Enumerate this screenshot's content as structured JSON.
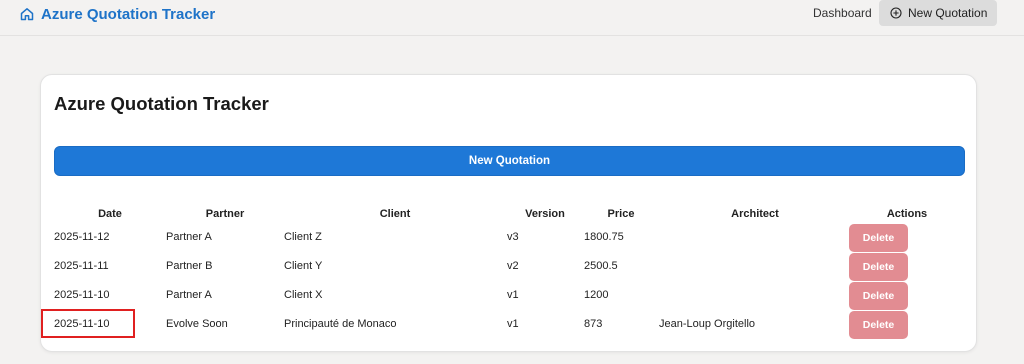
{
  "header": {
    "app_title": "Azure Quotation Tracker",
    "nav_dashboard": "Dashboard",
    "nav_new_quotation": "New Quotation"
  },
  "main": {
    "title": "Azure Quotation Tracker",
    "new_quotation_button": "New Quotation",
    "table": {
      "columns": [
        "Date",
        "Partner",
        "Client",
        "Version",
        "Price",
        "Architect",
        "Actions"
      ],
      "rows": [
        {
          "date": "2025-11-12",
          "partner": "Partner A",
          "client": "Client Z",
          "version": "v3",
          "price": "1800.75",
          "architect": "",
          "action": "Delete"
        },
        {
          "date": "2025-11-11",
          "partner": "Partner B",
          "client": "Client Y",
          "version": "v2",
          "price": "2500.5",
          "architect": "",
          "action": "Delete"
        },
        {
          "date": "2025-11-10",
          "partner": "Partner A",
          "client": "Client X",
          "version": "v1",
          "price": "1200",
          "architect": "",
          "action": "Delete"
        },
        {
          "date": "2025-11-10",
          "partner": "Evolve Soon",
          "client": "Principauté de Monaco",
          "version": "v1",
          "price": "873",
          "architect": "Jean-Loup Orgitello",
          "action": "Delete"
        }
      ]
    }
  },
  "colors": {
    "brand": "#1e73c8",
    "primary_button": "#1e78d7",
    "delete_button": "#e28c92",
    "highlight_border": "#e02020"
  },
  "icons": {
    "brand": "home-icon",
    "new_quotation": "plus-circle-icon"
  }
}
